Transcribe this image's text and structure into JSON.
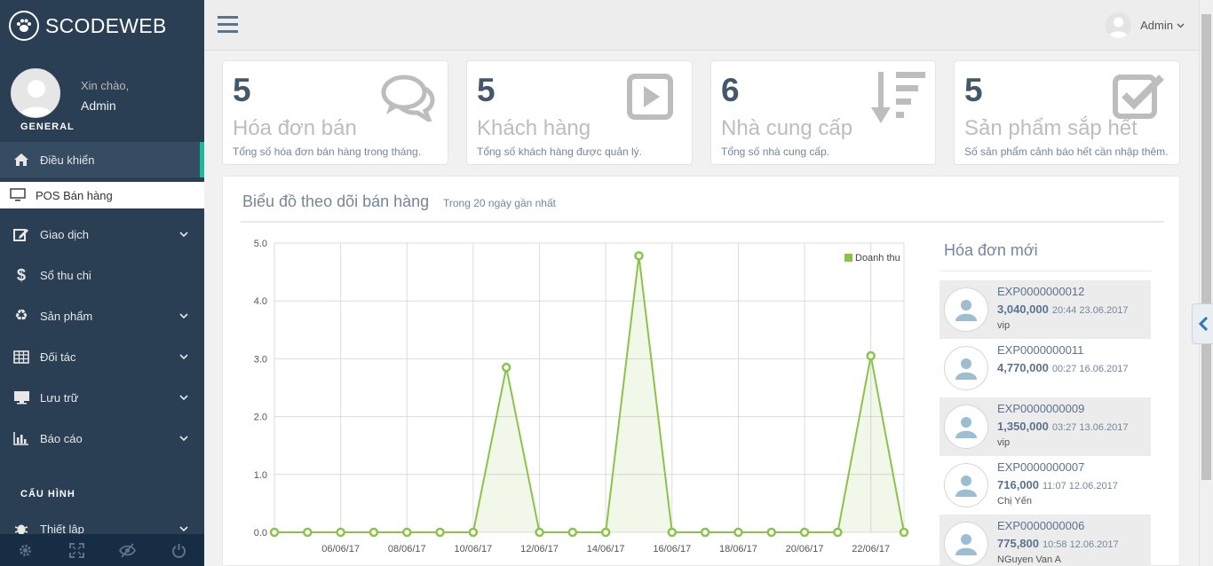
{
  "brand": {
    "name": "SCODEWEB",
    "logo_icon": "paw-icon"
  },
  "profile": {
    "greeting": "Xin chào,",
    "name": "Admin"
  },
  "sidebar": {
    "section_general": "GENERAL",
    "section_config": "CẤU HÌNH",
    "items": [
      {
        "label": "Điều khiển",
        "icon": "home-icon",
        "active": true
      },
      {
        "label": "POS Bán hàng",
        "icon": "monitor-icon"
      },
      {
        "label": "Giao dịch",
        "icon": "edit-icon",
        "has_children": true
      },
      {
        "label": "Sổ thu chi",
        "icon": "dollar-icon"
      },
      {
        "label": "Sản phẩm",
        "icon": "recycle-icon",
        "has_children": true
      },
      {
        "label": "Đối tác",
        "icon": "table-icon",
        "has_children": true
      },
      {
        "label": "Lưu trữ",
        "icon": "desktop-icon",
        "has_children": true
      },
      {
        "label": "Báo cáo",
        "icon": "bar-chart-icon",
        "has_children": true
      },
      {
        "label": "Thiết lập",
        "icon": "bug-icon",
        "has_children": true
      }
    ],
    "footer_icons": [
      "settings-icon",
      "fullscreen-icon",
      "eye-slash-icon",
      "power-icon"
    ]
  },
  "topbar": {
    "user_name": "Admin"
  },
  "tiles": [
    {
      "count": "5",
      "title": "Hóa đơn bán",
      "desc": "Tổng số hóa đơn bán hàng trong tháng.",
      "icon": "comments-icon"
    },
    {
      "count": "5",
      "title": "Khách hàng",
      "desc": "Tổng số khách hàng được quản lý.",
      "icon": "play-square-icon"
    },
    {
      "count": "6",
      "title": "Nhà cung cấp",
      "desc": "Tổng số nhà cung cấp.",
      "icon": "sort-amount-desc-icon"
    },
    {
      "count": "5",
      "title": "Sản phẩm sắp hết",
      "desc": "Số sản phẩm cảnh báo hết cần nhập thêm.",
      "icon": "check-square-icon"
    }
  ],
  "panel": {
    "title": "Biểu đồ theo dõi bán hàng",
    "subtitle": "Trong 20 ngày gần nhất"
  },
  "chart_data": {
    "type": "area",
    "x": [
      "04/06/17",
      "05/06/17",
      "06/06/17",
      "07/06/17",
      "08/06/17",
      "09/06/17",
      "10/06/17",
      "11/06/17",
      "12/06/17",
      "13/06/17",
      "14/06/17",
      "15/06/17",
      "16/06/17",
      "17/06/17",
      "18/06/17",
      "19/06/17",
      "20/06/17",
      "21/06/17",
      "22/06/17",
      "23/06/17"
    ],
    "x_tick_labels": [
      "06/06/17",
      "08/06/17",
      "10/06/17",
      "12/06/17",
      "14/06/17",
      "16/06/17",
      "18/06/17",
      "20/06/17",
      "22/06/17"
    ],
    "y_tick_labels": [
      "0.0",
      "1.0",
      "2.0",
      "3.0",
      "4.0",
      "5.0"
    ],
    "series": [
      {
        "name": "Doanh thu",
        "color": "#8bc34a",
        "values": [
          0,
          0,
          0,
          0,
          0,
          0,
          0,
          2.85,
          0,
          0,
          0,
          4.78,
          0,
          0,
          0,
          0,
          0,
          0,
          3.05,
          0
        ]
      }
    ],
    "ylim": [
      0,
      5
    ],
    "grid": true,
    "legend": "top-right"
  },
  "recent": {
    "title": "Hóa đơn mới",
    "items": [
      {
        "code": "EXP0000000012",
        "amount": "3,040,000",
        "time": "20:44 23.06.2017",
        "customer": "vip"
      },
      {
        "code": "EXP0000000011",
        "amount": "4,770,000",
        "time": "00:27 16.06.2017",
        "customer": ""
      },
      {
        "code": "EXP0000000009",
        "amount": "1,350,000",
        "time": "03:27 13.06.2017",
        "customer": "vip"
      },
      {
        "code": "EXP0000000007",
        "amount": "716,000",
        "time": "11:07 12.06.2017",
        "customer": "Chị Yến"
      },
      {
        "code": "EXP0000000006",
        "amount": "775,800",
        "time": "10:58 12.06.2017",
        "customer": "NGuyen Van A"
      }
    ]
  }
}
